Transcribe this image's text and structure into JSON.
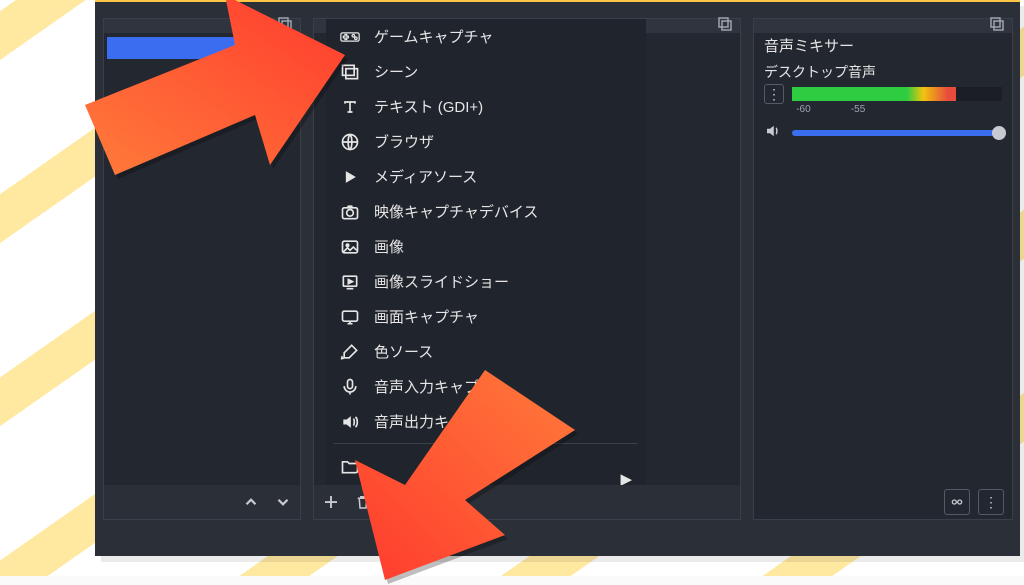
{
  "mixer": {
    "title": "音声ミキサー",
    "channel": "デスクトップ音声",
    "ticks": {
      "a": "-60",
      "b": "-55"
    }
  },
  "menu": {
    "items": [
      {
        "label": "ゲームキャプチャ",
        "icon": "gamepad"
      },
      {
        "label": "シーン",
        "icon": "layers"
      },
      {
        "label": "テキスト (GDI+)",
        "icon": "text"
      },
      {
        "label": "ブラウザ",
        "icon": "globe"
      },
      {
        "label": "メディアソース",
        "icon": "play"
      },
      {
        "label": "映像キャプチャデバイス",
        "icon": "camera"
      },
      {
        "label": "画像",
        "icon": "image"
      },
      {
        "label": "画像スライドショー",
        "icon": "slideshow"
      },
      {
        "label": "画面キャプチャ",
        "icon": "monitor"
      },
      {
        "label": "色ソース",
        "icon": "brush"
      },
      {
        "label": "音声入力キャプチャ",
        "icon": "mic"
      },
      {
        "label": "音声出力キ",
        "icon": "speaker"
      }
    ],
    "group_icon": "folder"
  },
  "colors": {
    "accent": "#3a6df0",
    "panel": "#232730",
    "bg": "#2b2f38"
  }
}
